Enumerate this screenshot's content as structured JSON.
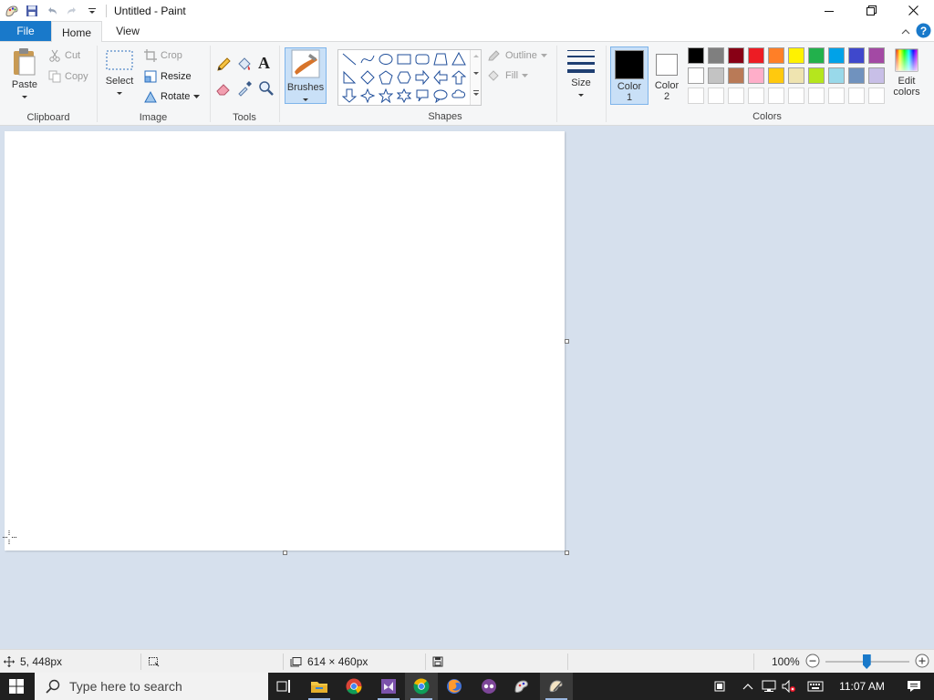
{
  "window": {
    "title": "Untitled - Paint"
  },
  "tabs": {
    "file": "File",
    "home": "Home",
    "view": "View"
  },
  "clipboard": {
    "paste": "Paste",
    "cut": "Cut",
    "copy": "Copy",
    "group_label": "Clipboard"
  },
  "image": {
    "select": "Select",
    "crop": "Crop",
    "resize": "Resize",
    "rotate": "Rotate",
    "group_label": "Image"
  },
  "tools": {
    "group_label": "Tools",
    "text_glyph": "A"
  },
  "brushes": {
    "label": "Brushes"
  },
  "shapes": {
    "outline": "Outline",
    "fill": "Fill",
    "group_label": "Shapes"
  },
  "size": {
    "label": "Size"
  },
  "color1": {
    "label_line1": "Color",
    "label_line2": "1",
    "value": "#000000"
  },
  "color2": {
    "label_line1": "Color",
    "label_line2": "2",
    "value": "#ffffff"
  },
  "colors": {
    "group_label": "Colors",
    "edit_line1": "Edit",
    "edit_line2": "colors",
    "palette_row1": [
      "#000000",
      "#7f7f7f",
      "#880015",
      "#ed1c24",
      "#ff7f27",
      "#fff200",
      "#22b14c",
      "#00a2e8",
      "#3f48cc",
      "#a349a4"
    ],
    "palette_row2": [
      "#ffffff",
      "#c3c3c3",
      "#b97a57",
      "#ffaec9",
      "#ffc90e",
      "#efe4b0",
      "#b5e61d",
      "#99d9ea",
      "#7092be",
      "#c8bfe7"
    ]
  },
  "status": {
    "cursor_pos": "5, 448px",
    "canvas_size": "614 × 460px",
    "zoom": "100%"
  },
  "taskbar": {
    "search_placeholder": "Type here to search",
    "time": "11:07 AM"
  }
}
